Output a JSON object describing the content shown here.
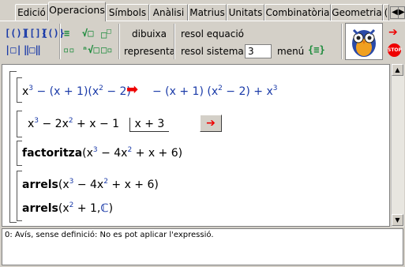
{
  "tabs": [
    "Edició",
    "Operacions",
    "Símbols",
    "Anàlisi",
    "Matrius",
    "Unitats",
    "Combinatòria",
    "Geometria",
    "("
  ],
  "active_tab": "Operacions",
  "tab_scroll_icons": [
    "tab-scroll-left-icon",
    "tab-scroll-right-icon"
  ],
  "toolbar": {
    "dibuixa": "dibuixa",
    "representa": "representa",
    "resol_equacio": "resol equació",
    "resol_sistema": "resol sistema",
    "sistema_value": "3",
    "menu": "menú"
  },
  "worksheet": {
    "line1": {
      "input": [
        "x",
        "3",
        " − (x + 1)(x",
        "2",
        " − 2)"
      ],
      "result": [
        "− (x + 1) (x",
        "2",
        " − 2) + x",
        "3"
      ]
    },
    "line2": {
      "dividend": [
        "x",
        "3",
        " − 2x",
        "2",
        " + x − 1"
      ],
      "divisor": "x + 3"
    },
    "line3": {
      "fn": "factoritza",
      "args": [
        "(x",
        "3",
        " − 4x",
        "2",
        " + x + 6)"
      ]
    },
    "line4": {
      "fn": "arrels",
      "args": [
        "(x",
        "3",
        " − 4x",
        "2",
        " + x + 6)"
      ]
    },
    "line5": {
      "fn": "arrels",
      "args": [
        "(x",
        "2",
        " + 1,",
        "ℂ",
        ")"
      ]
    }
  },
  "status": "0: Avís, sense definició: No es pot aplicar l'expressió."
}
